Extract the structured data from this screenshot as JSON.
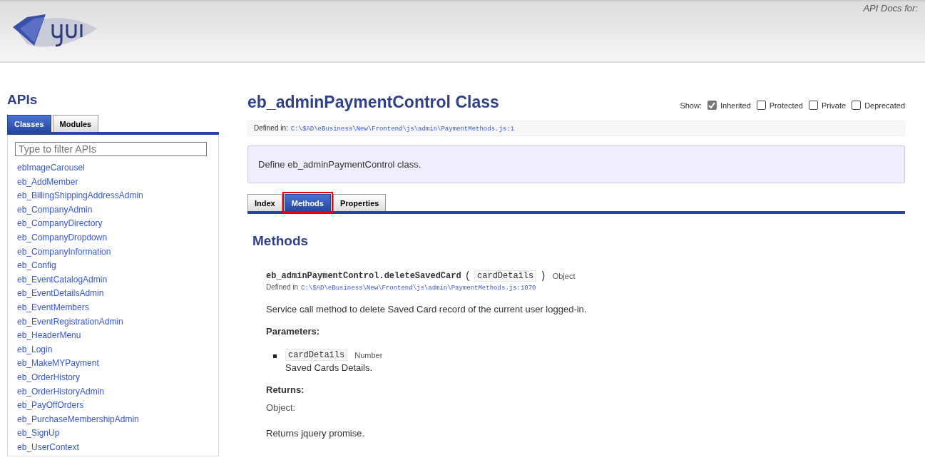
{
  "header": {
    "docs_label": "API Docs for:"
  },
  "sidebar": {
    "title": "APIs",
    "tabs": [
      {
        "label": "Classes",
        "selected": true
      },
      {
        "label": "Modules",
        "selected": false
      }
    ],
    "filter": {
      "placeholder": "Type to filter APIs"
    },
    "items": [
      "ebImageCarousel",
      "eb_AddMember",
      "eb_BillingShippingAddressAdmin",
      "eb_CompanyAdmin",
      "eb_CompanyDirectory",
      "eb_CompanyDropdown",
      "eb_CompanyInformation",
      "eb_Config",
      "eb_EventCatalogAdmin",
      "eb_EventDetailsAdmin",
      "eb_EventMembers",
      "eb_EventRegistrationAdmin",
      "eb_HeaderMenu",
      "eb_Login",
      "eb_MakeMYPayment",
      "eb_OrderHistory",
      "eb_OrderHistoryAdmin",
      "eb_PayOffOrders",
      "eb_PurchaseMembershipAdmin",
      "eb_SignUp",
      "eb_UserContext"
    ]
  },
  "main": {
    "title": "eb_adminPaymentControl Class",
    "show": {
      "label": "Show:",
      "options": [
        {
          "label": "Inherited",
          "checked": true
        },
        {
          "label": "Protected",
          "checked": false
        },
        {
          "label": "Private",
          "checked": false
        },
        {
          "label": "Deprecated",
          "checked": false
        }
      ]
    },
    "defined_in": {
      "label": "Defined in:",
      "path": "C:\\$AD\\eBusiness\\New\\Frontend\\js\\admin\\PaymentMethods.js:1"
    },
    "description": "Define eb_adminPaymentControl class.",
    "tabs": [
      {
        "label": "Index",
        "selected": false
      },
      {
        "label": "Methods",
        "selected": true
      },
      {
        "label": "Properties",
        "selected": false
      }
    ],
    "section_title": "Methods",
    "method": {
      "name": "eb_adminPaymentControl.deleteSavedCard",
      "open_paren": "(",
      "param": "cardDetails",
      "close_paren": ")",
      "return_type": "Object",
      "defined_label": "Defined in",
      "defined_path": "C:\\$AD\\eBusiness\\New\\Frontend\\js\\admin\\PaymentMethods.js:1070",
      "description": "Service call method to delete Saved Card record of the current user logged-in.",
      "params_title": "Parameters:",
      "params": [
        {
          "name": "cardDetails",
          "type": "Number",
          "description": "Saved Cards Details."
        }
      ],
      "returns_title": "Returns:",
      "returns_type": "Object:",
      "returns_description": "Returns jquery promise."
    }
  }
}
